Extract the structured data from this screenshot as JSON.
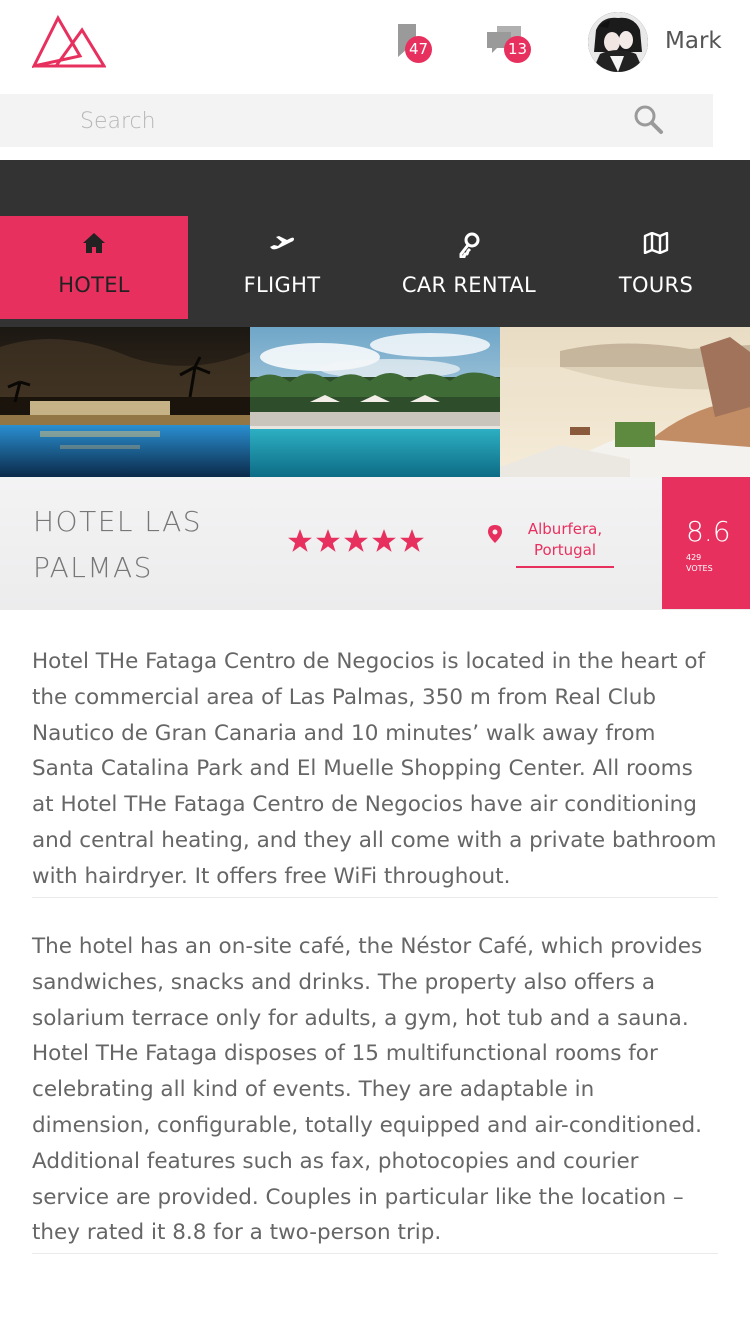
{
  "header": {
    "user_name": "Mark",
    "bookmark_count": "47",
    "message_count": "13"
  },
  "search": {
    "placeholder": "Search"
  },
  "tabs": [
    {
      "label": "HOTEL",
      "icon": "home-icon",
      "active": true
    },
    {
      "label": "FLIGHT",
      "icon": "plane-icon",
      "active": false
    },
    {
      "label": "CAR RENTAL",
      "icon": "key-icon",
      "active": false
    },
    {
      "label": "TOURS",
      "icon": "map-icon",
      "active": false
    }
  ],
  "hotel": {
    "name": "HOTEL LAS PALMAS",
    "rating_stars": 5,
    "location": "Alburfera, Portugal",
    "score": "8.6",
    "votes": "429",
    "votes_label": "VOTES"
  },
  "description": {
    "paragraph1": "Hotel THe Fataga Centro de Negocios is located in the heart of the commercial area of Las Palmas, 350 m from Real Club Nautico de Gran Canaria and 10 minutes’ walk away from Santa Catalina Park and El Muelle Shopping Center. All rooms at Hotel THe Fataga Centro de Negocios have air conditioning and central heating, and they all come with a private bathroom with hairdryer. It offers free WiFi throughout.",
    "paragraph2": "The hotel has an on-site café, the Néstor Café, which provides sandwiches, snacks and drinks. The property also offers a solarium terrace only for adults, a gym, hot tub and a sauna. Hotel THe Fataga disposes of 15 multifunctional rooms for celebrating all kind of events. They are adaptable in dimension, configurable, totally equipped and air-conditioned. Additional features such as fax, photocopies and courier service are provided. Couples in particular like the location – they rated it 8.8 for a two-person trip."
  },
  "colors": {
    "accent": "#e8305f",
    "dark_bar": "#333333",
    "text": "#666666"
  }
}
